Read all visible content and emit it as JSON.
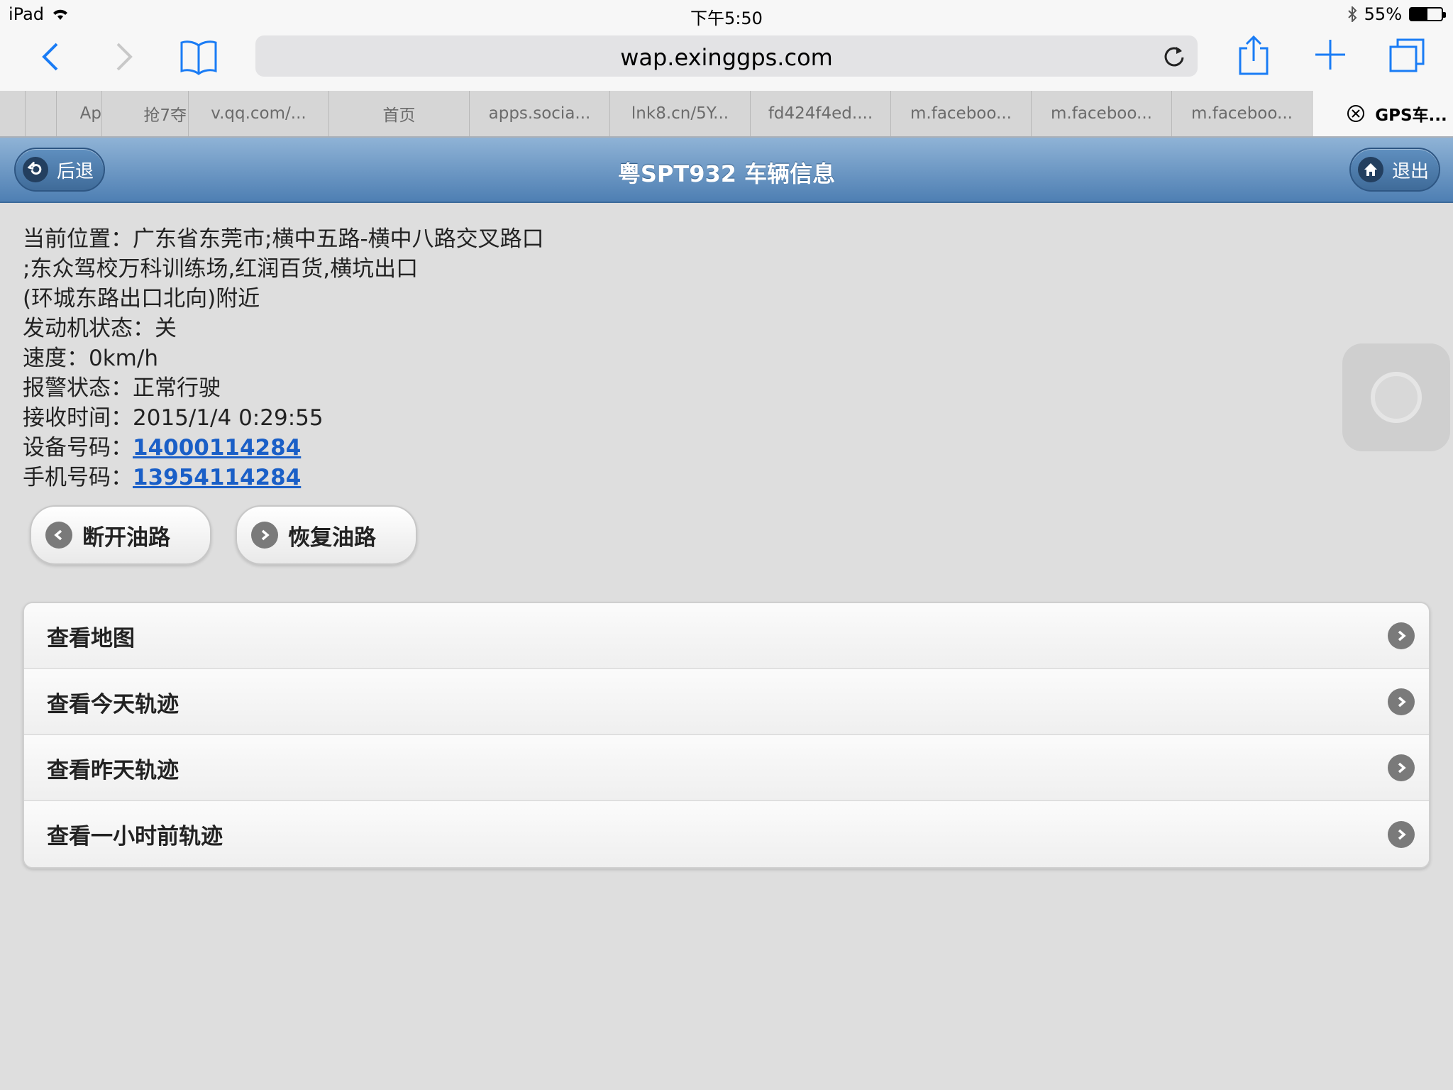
{
  "status_bar": {
    "device": "iPad",
    "time": "下午5:50",
    "battery": "55%",
    "battery_level": 0.55
  },
  "browser": {
    "url": "wap.exinggps.com",
    "tabs": [
      {
        "label": ""
      },
      {
        "label": "Ap"
      },
      {
        "label": "抢7夺"
      },
      {
        "label": "v.qq.com/..."
      },
      {
        "label": "首页"
      },
      {
        "label": "apps.socia..."
      },
      {
        "label": "lnk8.cn/5Y..."
      },
      {
        "label": "fd424f4ed...."
      },
      {
        "label": "m.faceboo..."
      },
      {
        "label": "m.faceboo..."
      },
      {
        "label": "m.faceboo..."
      },
      {
        "label": "GPS车..."
      }
    ]
  },
  "header": {
    "back_label": "后退",
    "title": "粤SPT932 车辆信息",
    "exit_label": "退出"
  },
  "info": {
    "location_line1": "当前位置：广东省东莞市;横中五路-横中八路交叉路口",
    "location_line2": ";东众驾校万科训练场,红润百货,横坑出口",
    "location_line3": "(环城东路出口北向)附近",
    "engine": "发动机状态：关",
    "speed": "速度：0km/h",
    "alarm": "报警状态：正常行驶",
    "receive_time": "接收时间：2015/1/4 0:29:55",
    "device_label": "设备号码：",
    "device_number": "14000114284",
    "phone_label": "手机号码：",
    "phone_number": "13954114284"
  },
  "actions": {
    "cut_oil": "断开油路",
    "restore_oil": "恢复油路"
  },
  "menu": [
    {
      "label": "查看地图"
    },
    {
      "label": "查看今天轨迹"
    },
    {
      "label": "查看昨天轨迹"
    },
    {
      "label": "查看一小时前轨迹"
    }
  ]
}
